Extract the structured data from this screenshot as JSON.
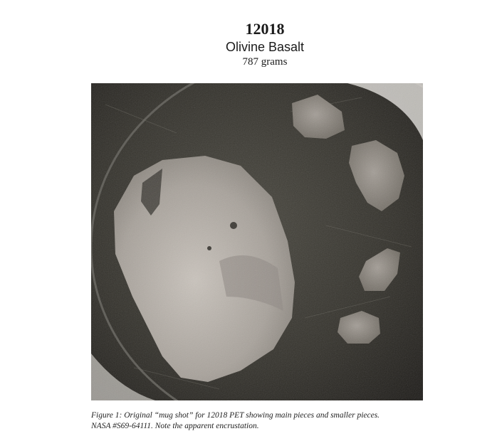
{
  "header": {
    "sample_id": "12018",
    "rock_type": "Olivine Basalt",
    "mass": "787 grams"
  },
  "figure": {
    "caption_line1": "Figure 1:  Original “mug shot” for 12018 PET showing main pieces and smaller pieces.",
    "caption_line2": "NASA #S69-64111.  Note the apparent encrustation."
  }
}
